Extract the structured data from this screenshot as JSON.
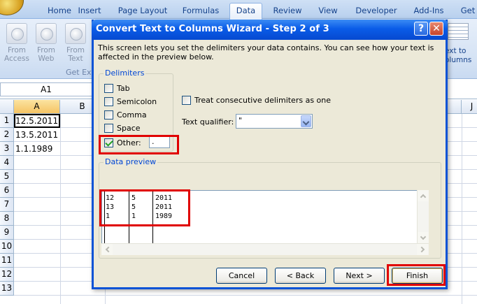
{
  "ribbon": {
    "tabs": [
      "Home",
      "Insert",
      "Page Layout",
      "Formulas",
      "Data",
      "Review",
      "View",
      "Developer",
      "Add-Ins",
      "Get"
    ],
    "active_tab": "Data",
    "buttons": [
      {
        "line1": "From",
        "line2": "Access"
      },
      {
        "line1": "From",
        "line2": "Web"
      },
      {
        "line1": "From",
        "line2": "Text"
      }
    ],
    "group_label": "Get Ext",
    "right_label_line1": "ext to",
    "right_label_line2": "olumns"
  },
  "formula_bar": {
    "name_box": "A1"
  },
  "sheet": {
    "columns": [
      "A",
      "B",
      "J"
    ],
    "rows": [
      "1",
      "2",
      "3",
      "4",
      "5",
      "6",
      "7",
      "8",
      "9",
      "10",
      "11",
      "12",
      "13"
    ],
    "cells": [
      "12.5.2011",
      "13.5.2011",
      "1.1.1989"
    ]
  },
  "dialog": {
    "title": "Convert Text to Columns Wizard - Step 2 of 3",
    "help": "?",
    "close": "✕",
    "intro": "This screen lets you set the delimiters your data contains.  You can see how your text is affected in the preview below.",
    "delimiters_legend": "Delimiters",
    "tab": "Tab",
    "semicolon": "Semicolon",
    "comma": "Comma",
    "space": "Space",
    "other": "Other:",
    "other_value": ".",
    "consecutive": "Treat consecutive delimiters as one",
    "qualifier_label": "Text qualifier:",
    "qualifier_value": "\"",
    "preview_legend": "Data preview",
    "preview_rows": [
      [
        "12",
        "5",
        "2011"
      ],
      [
        "13",
        "5",
        "2011"
      ],
      [
        "1",
        "1",
        "1989"
      ]
    ],
    "buttons": {
      "cancel": "Cancel",
      "back": "< Back",
      "next": "Next >",
      "finish": "Finish"
    }
  }
}
